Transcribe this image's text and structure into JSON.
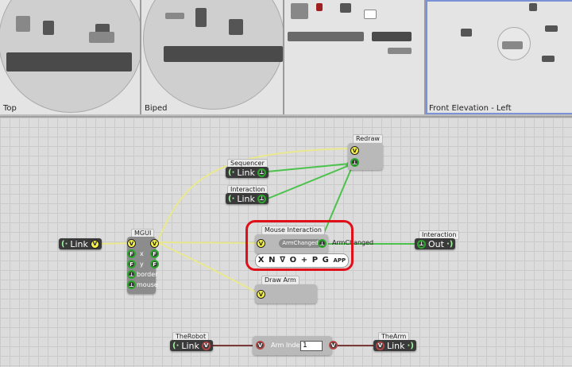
{
  "viewports": [
    {
      "label": "Top"
    },
    {
      "label": "Biped"
    },
    {
      "label": ""
    },
    {
      "label": "Front Elevation - Left"
    }
  ],
  "nodes": {
    "redraw": {
      "title": "Redraw"
    },
    "sequencer": {
      "title": "Sequencer",
      "link_label": "Link"
    },
    "interaction_in": {
      "title": "Interaction",
      "link_label": "Link"
    },
    "left_link": {
      "link_label": "Link"
    },
    "mgui": {
      "title": "MGUI",
      "rows": [
        {
          "left": "V",
          "label": "",
          "right": "V"
        },
        {
          "left": "F",
          "label": "x",
          "right": "F"
        },
        {
          "left": "F",
          "label": "y",
          "right": "F"
        },
        {
          "left": "",
          "label": "border",
          "right": ""
        },
        {
          "left": "",
          "label": "mouse",
          "right": ""
        }
      ]
    },
    "mouse_interaction": {
      "title": "Mouse Interaction",
      "field_label": "ArmChanged",
      "out_label": "ArmChanged",
      "toolbar": [
        "X",
        "N",
        "∇",
        "O",
        "+",
        "P",
        "G",
        "APP"
      ]
    },
    "interaction_out": {
      "title": "Interaction",
      "out_label": "Out"
    },
    "draw_arm": {
      "title": "Draw Arm"
    },
    "the_robot": {
      "title": "TheRobot",
      "link_label": "Link"
    },
    "arm_index": {
      "label": "Arm Index:",
      "value": "1"
    },
    "the_arm": {
      "title": "TheArm",
      "link_label": "Link"
    }
  },
  "colors": {
    "wire_yellow": "#e9e88e",
    "wire_green": "#4cc24c",
    "wire_red": "#7a3a3a",
    "highlight": "#e0101a"
  }
}
